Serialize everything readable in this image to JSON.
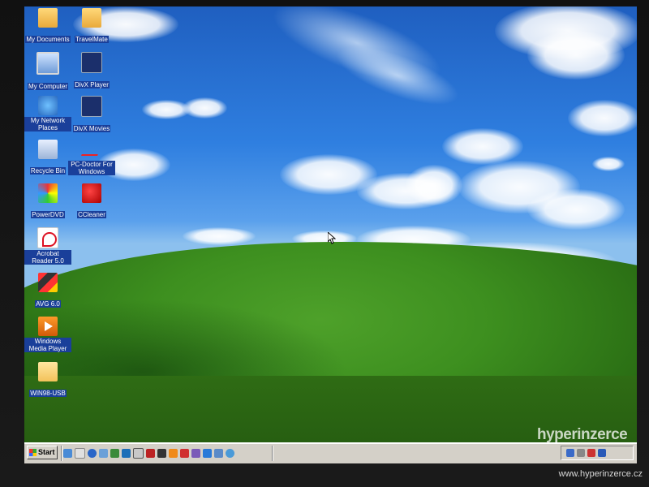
{
  "desktop": {
    "icons": [
      {
        "label": "My Documents",
        "icon": "my-documents-icon"
      },
      {
        "label": "TravelMate",
        "icon": "folder-icon"
      },
      {
        "label": "My Computer",
        "icon": "my-computer-icon"
      },
      {
        "label": "DivX Player",
        "icon": "divx-player-icon"
      },
      {
        "label": "My Network Places",
        "icon": "network-places-icon"
      },
      {
        "label": "DivX Movies",
        "icon": "divx-movies-icon"
      },
      {
        "label": "Recycle Bin",
        "icon": "recycle-bin-icon"
      },
      {
        "label": "PC-Doctor For Windows",
        "icon": "pc-doctor-icon"
      },
      {
        "label": "PowerDVD",
        "icon": "powerdvd-icon"
      },
      {
        "label": "CCleaner",
        "icon": "ccleaner-icon"
      },
      {
        "label": "Acrobat Reader 5.0",
        "icon": "acrobat-reader-icon"
      },
      {
        "label": "AVG 6.0",
        "icon": "avg-icon"
      },
      {
        "label": "Windows Media Player",
        "icon": "windows-media-player-icon"
      },
      {
        "label": "WIN98-USB",
        "icon": "folder-icon"
      }
    ]
  },
  "taskbar": {
    "start_label": "Start",
    "quick_launch_count": 15,
    "tray_icons": [
      "network-icon",
      "volume-icon",
      "antivirus-icon",
      "display-icon"
    ]
  },
  "watermark": {
    "logo": "hyperinzerce",
    "url": "www.hyperinzerce.cz"
  },
  "colors": {
    "sky": "#2f7fe0",
    "hill": "#3d8f1f",
    "taskbar": "#d4d0c8",
    "icon_label_bg": "#1a3f9a"
  }
}
